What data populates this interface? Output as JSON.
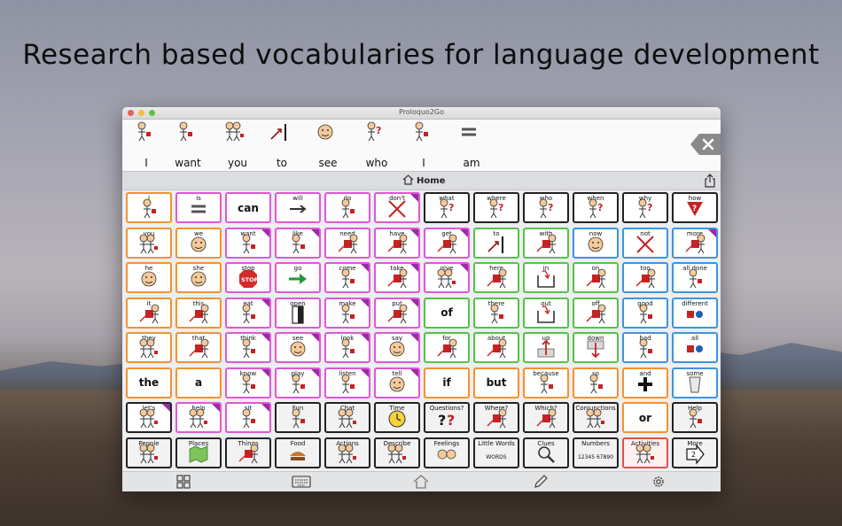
{
  "headline": "Research based vocabularies for language development",
  "window": {
    "title": "Proloquo2Go"
  },
  "message": {
    "words": [
      "I",
      "want",
      "you",
      "to",
      "see",
      "who",
      "I",
      "am"
    ]
  },
  "nav": {
    "home_label": "Home"
  },
  "colors": {
    "orange": "#f29331",
    "pink": "#df58d6",
    "green": "#55c24a",
    "blue": "#3d94e0",
    "black": "#222222",
    "folder_corner": "#9a2aa8"
  },
  "grid": {
    "cells": [
      {
        "label": "I",
        "color": "orange",
        "pic": "person"
      },
      {
        "label": "is",
        "color": "pink",
        "pic": "equals"
      },
      {
        "label": "can",
        "color": "pink",
        "big": true
      },
      {
        "label": "will",
        "color": "pink",
        "pic": "arrow"
      },
      {
        "label": "do",
        "color": "pink",
        "pic": "person"
      },
      {
        "label": "don't",
        "color": "pink",
        "pic": "cross",
        "fold": true
      },
      {
        "label": "what",
        "color": "black",
        "pic": "question"
      },
      {
        "label": "where",
        "color": "black",
        "pic": "question"
      },
      {
        "label": "who",
        "color": "black",
        "pic": "question"
      },
      {
        "label": "when",
        "color": "black",
        "pic": "question"
      },
      {
        "label": "why",
        "color": "black",
        "pic": "question"
      },
      {
        "label": "how",
        "color": "black",
        "pic": "redq"
      },
      {
        "label": "you",
        "color": "orange",
        "pic": "people"
      },
      {
        "label": "we",
        "color": "orange",
        "pic": "face"
      },
      {
        "label": "want",
        "color": "pink",
        "pic": "person",
        "fold": true
      },
      {
        "label": "like",
        "color": "pink",
        "pic": "person",
        "fold": true
      },
      {
        "label": "need",
        "color": "pink",
        "pic": "box"
      },
      {
        "label": "have",
        "color": "pink",
        "pic": "box",
        "fold": true
      },
      {
        "label": "get",
        "color": "pink",
        "pic": "box",
        "fold": true
      },
      {
        "label": "to",
        "color": "green",
        "pic": "to"
      },
      {
        "label": "with",
        "color": "green",
        "pic": "box"
      },
      {
        "label": "now",
        "color": "blue",
        "pic": "face"
      },
      {
        "label": "not",
        "color": "blue",
        "pic": "cross"
      },
      {
        "label": "more",
        "color": "blue",
        "pic": "box",
        "fold": true
      },
      {
        "label": "he",
        "color": "orange",
        "pic": "face"
      },
      {
        "label": "she",
        "color": "orange",
        "pic": "face"
      },
      {
        "label": "stop",
        "color": "pink",
        "pic": "stop"
      },
      {
        "label": "go",
        "color": "pink",
        "pic": "go"
      },
      {
        "label": "come",
        "color": "pink",
        "pic": "person",
        "fold": true
      },
      {
        "label": "take",
        "color": "pink",
        "pic": "box",
        "fold": true
      },
      {
        "label": "give",
        "color": "pink",
        "pic": "people",
        "fold": true
      },
      {
        "label": "here",
        "color": "green",
        "pic": "box"
      },
      {
        "label": "in",
        "color": "green",
        "pic": "in"
      },
      {
        "label": "on",
        "color": "green",
        "pic": "box"
      },
      {
        "label": "too",
        "color": "blue",
        "pic": "box"
      },
      {
        "label": "all done",
        "color": "blue",
        "pic": "person"
      },
      {
        "label": "it",
        "color": "orange",
        "pic": "box"
      },
      {
        "label": "this",
        "color": "orange",
        "pic": "box"
      },
      {
        "label": "eat",
        "color": "pink",
        "pic": "person",
        "fold": true
      },
      {
        "label": "open",
        "color": "pink",
        "pic": "door"
      },
      {
        "label": "make",
        "color": "pink",
        "pic": "person",
        "fold": true
      },
      {
        "label": "put",
        "color": "pink",
        "pic": "box",
        "fold": true
      },
      {
        "label": "of",
        "color": "green",
        "big": true
      },
      {
        "label": "there",
        "color": "green",
        "pic": "person"
      },
      {
        "label": "out",
        "color": "green",
        "pic": "in"
      },
      {
        "label": "off",
        "color": "green",
        "pic": "box"
      },
      {
        "label": "good",
        "color": "blue",
        "pic": "person"
      },
      {
        "label": "different",
        "color": "blue",
        "pic": "shapes"
      },
      {
        "label": "they",
        "color": "orange",
        "pic": "people"
      },
      {
        "label": "that",
        "color": "orange",
        "pic": "box"
      },
      {
        "label": "think",
        "color": "pink",
        "pic": "person",
        "fold": true
      },
      {
        "label": "see",
        "color": "pink",
        "pic": "face",
        "fold": true
      },
      {
        "label": "look",
        "color": "pink",
        "pic": "person",
        "fold": true
      },
      {
        "label": "say",
        "color": "pink",
        "pic": "face",
        "fold": true
      },
      {
        "label": "for",
        "color": "green",
        "pic": "box"
      },
      {
        "label": "about",
        "color": "green",
        "pic": "box"
      },
      {
        "label": "up",
        "color": "green",
        "pic": "up"
      },
      {
        "label": "down",
        "color": "green",
        "pic": "down"
      },
      {
        "label": "bad",
        "color": "blue",
        "pic": "person"
      },
      {
        "label": "all",
        "color": "blue",
        "pic": "shapes"
      },
      {
        "label": "the",
        "color": "orange",
        "big": true
      },
      {
        "label": "a",
        "color": "orange",
        "big": true
      },
      {
        "label": "know",
        "color": "pink",
        "pic": "person",
        "fold": true
      },
      {
        "label": "play",
        "color": "pink",
        "pic": "person",
        "fold": true
      },
      {
        "label": "listen",
        "color": "pink",
        "pic": "person",
        "fold": true
      },
      {
        "label": "tell",
        "color": "pink",
        "pic": "face",
        "fold": true
      },
      {
        "label": "if",
        "color": "orange",
        "big": true
      },
      {
        "label": "but",
        "color": "orange",
        "big": true
      },
      {
        "label": "because",
        "color": "orange",
        "pic": "person"
      },
      {
        "label": "so",
        "color": "orange",
        "pic": "person"
      },
      {
        "label": "and",
        "color": "orange",
        "pic": "plus"
      },
      {
        "label": "some",
        "color": "blue",
        "pic": "cup"
      },
      {
        "label": "let's",
        "color": "black",
        "pic": "people",
        "fold": true
      },
      {
        "label": "help",
        "color": "pink",
        "pic": "people",
        "fold": true
      },
      {
        "label": "sit",
        "color": "pink",
        "pic": "person",
        "fold": true
      },
      {
        "label": "Fun",
        "color": "black",
        "pic": "person",
        "folder": true
      },
      {
        "label": "Chat",
        "color": "black",
        "pic": "people",
        "folder": true
      },
      {
        "label": "Time",
        "color": "black",
        "pic": "clock",
        "folder": true
      },
      {
        "label": "Questions?",
        "color": "black",
        "pic": "qq",
        "folder": true
      },
      {
        "label": "Where?",
        "color": "black",
        "pic": "box",
        "folder": true
      },
      {
        "label": "Which?",
        "color": "black",
        "pic": "box",
        "folder": true
      },
      {
        "label": "Conjunctions",
        "color": "black",
        "pic": "people",
        "folder": true
      },
      {
        "label": "or",
        "color": "orange",
        "big": true
      },
      {
        "label": "Help",
        "color": "black",
        "pic": "person",
        "folder": true
      },
      {
        "label": "People",
        "color": "black",
        "pic": "people",
        "folder": true
      },
      {
        "label": "Places",
        "color": "black",
        "pic": "map",
        "folder": true
      },
      {
        "label": "Things",
        "color": "black",
        "pic": "box",
        "folder": true
      },
      {
        "label": "Food",
        "color": "black",
        "pic": "food",
        "folder": true
      },
      {
        "label": "Actions",
        "color": "black",
        "pic": "people",
        "folder": true
      },
      {
        "label": "Describe",
        "color": "black",
        "pic": "people",
        "folder": true
      },
      {
        "label": "Feelings",
        "color": "black",
        "pic": "faces",
        "folder": true
      },
      {
        "label": "Little Words",
        "color": "black",
        "pic": "words",
        "folder": true,
        "subtext": "WORDS"
      },
      {
        "label": "Clues",
        "color": "black",
        "pic": "magnifier",
        "folder": true
      },
      {
        "label": "Numbers",
        "color": "black",
        "pic": "numbers",
        "folder": true,
        "subtext": "12345 67890"
      },
      {
        "label": "Activities",
        "color": "redborder",
        "pic": "people",
        "folder": true
      },
      {
        "label": "More",
        "color": "black",
        "pic": "more",
        "folder": true
      }
    ]
  },
  "toolbar": {
    "icons": [
      "grid-icon",
      "keyboard-icon",
      "home-icon",
      "pencil-icon",
      "gear-icon"
    ]
  }
}
